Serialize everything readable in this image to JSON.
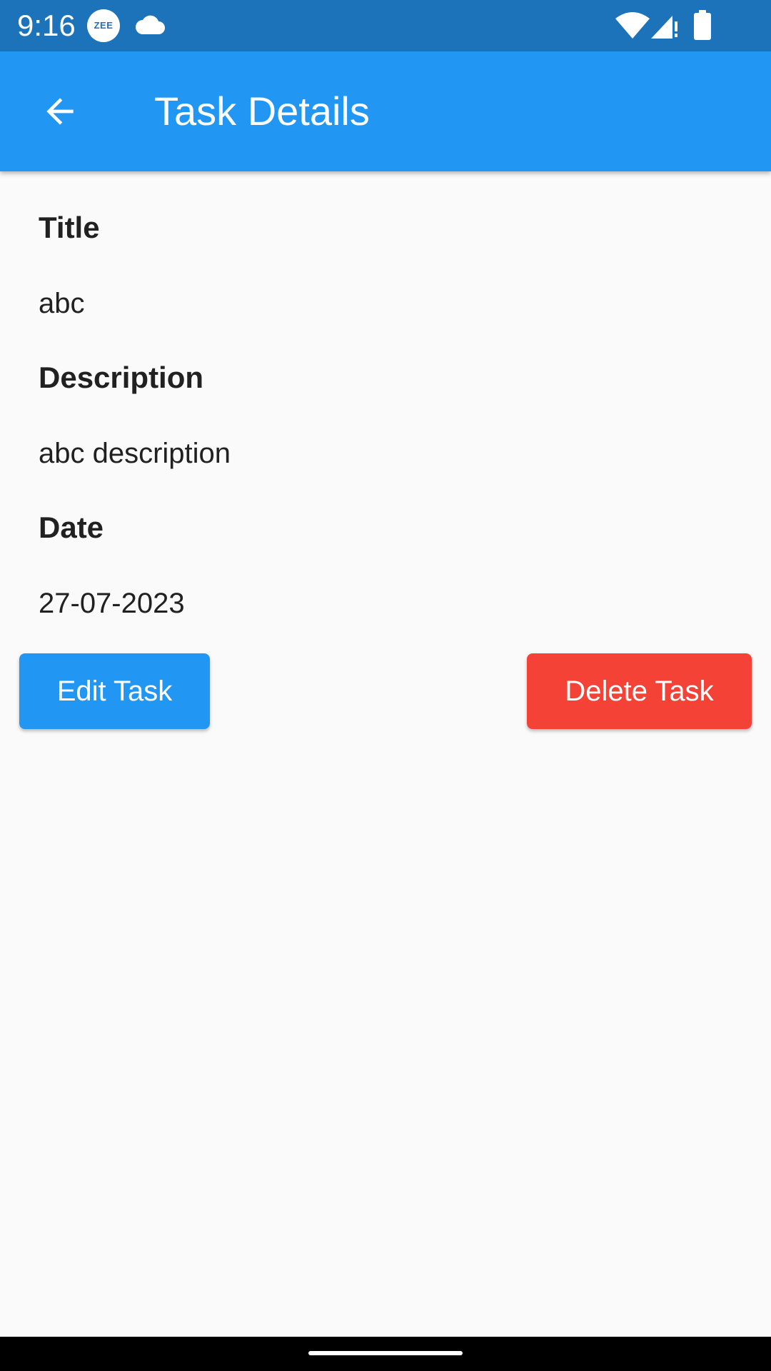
{
  "status_bar": {
    "time": "9:16",
    "badge": "ZEE",
    "icons": [
      "zee-app-icon",
      "cloud-icon",
      "wifi-icon",
      "signal-icon",
      "battery-icon"
    ],
    "background": "#1C73BA"
  },
  "app_bar": {
    "title": "Task Details",
    "back_icon": "arrow-back-icon",
    "background": "#2196F3"
  },
  "task": {
    "title_label": "Title",
    "title_value": "abc",
    "description_label": "Description",
    "description_value": "abc description",
    "date_label": "Date",
    "date_value": "27-07-2023"
  },
  "actions": {
    "edit_label": "Edit Task",
    "edit_color": "#2196F3",
    "delete_label": "Delete Task",
    "delete_color": "#F44336"
  }
}
